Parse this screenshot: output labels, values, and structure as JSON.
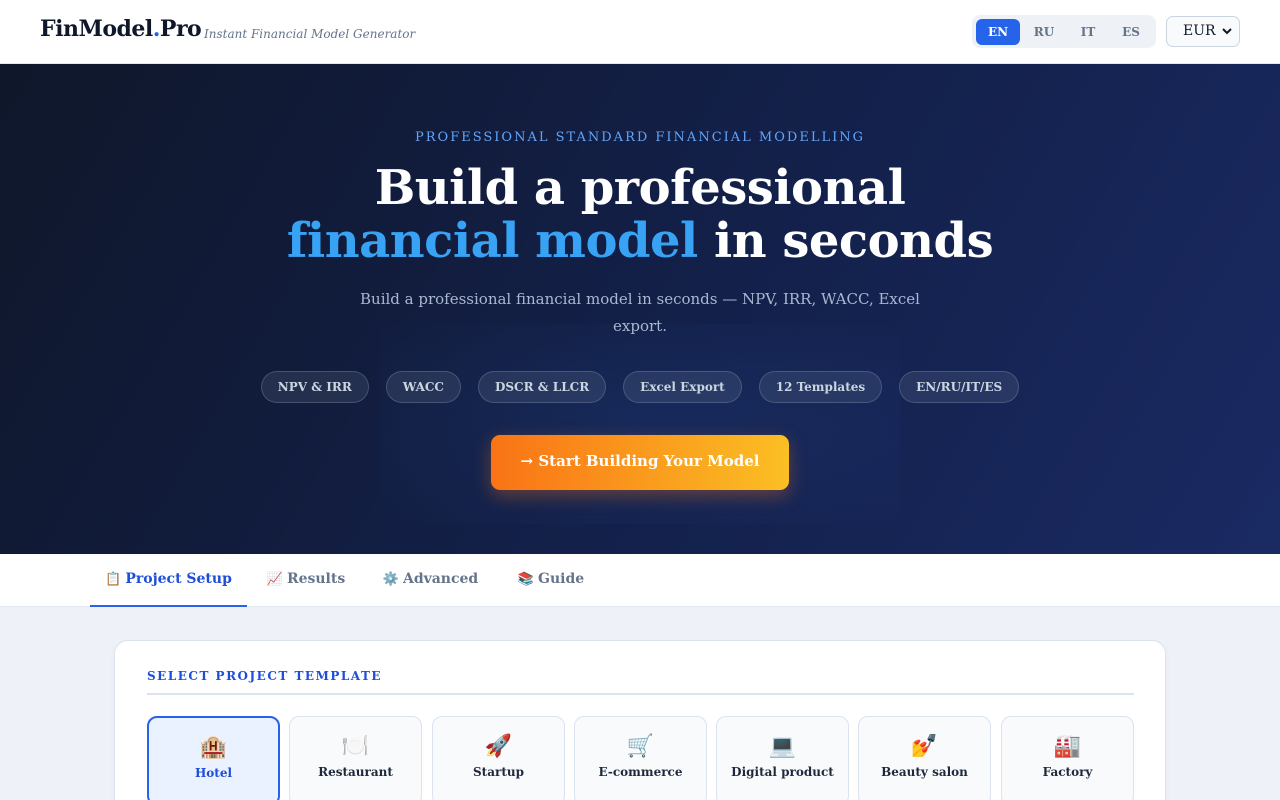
{
  "header": {
    "logo_main": "FinModel",
    "logo_dot": ".",
    "logo_suffix": "Pro",
    "tagline": "Instant Financial Model Generator",
    "languages": [
      "EN",
      "RU",
      "IT",
      "ES"
    ],
    "active_language": "EN",
    "currency": "EUR"
  },
  "hero": {
    "eyebrow": "PROFESSIONAL STANDARD FINANCIAL MODELLING",
    "headline_line1": "Build a professional",
    "headline_accent": "financial model",
    "headline_rest": " in seconds",
    "subtitle": "Build a professional financial model in seconds — NPV, IRR, WACC, Excel export.",
    "chips": [
      "NPV & IRR",
      "WACC",
      "DSCR & LLCR",
      "Excel Export",
      "12 Templates",
      "EN/RU/IT/ES"
    ],
    "cta_label": "→ Start Building Your Model"
  },
  "tabs": [
    {
      "icon": "📋",
      "label": "Project Setup",
      "active": true
    },
    {
      "icon": "📈",
      "label": "Results",
      "active": false
    },
    {
      "icon": "⚙️",
      "label": "Advanced",
      "active": false
    },
    {
      "icon": "📚",
      "label": "Guide",
      "active": false
    }
  ],
  "templates": {
    "title": "SELECT PROJECT TEMPLATE",
    "items": [
      {
        "icon": "🏨",
        "label": "Hotel",
        "active": true
      },
      {
        "icon": "🍽️",
        "label": "Restaurant",
        "active": false
      },
      {
        "icon": "🚀",
        "label": "Startup",
        "active": false
      },
      {
        "icon": "🛒",
        "label": "E-commerce",
        "active": false
      },
      {
        "icon": "💻",
        "label": "Digital product",
        "active": false
      },
      {
        "icon": "💅",
        "label": "Beauty salon",
        "active": false
      },
      {
        "icon": "🏭",
        "label": "Factory",
        "active": false
      }
    ]
  },
  "colors": {
    "brand": "#2563eb",
    "accent_orange": "#f97316",
    "hero_bg": "#0f172a"
  }
}
